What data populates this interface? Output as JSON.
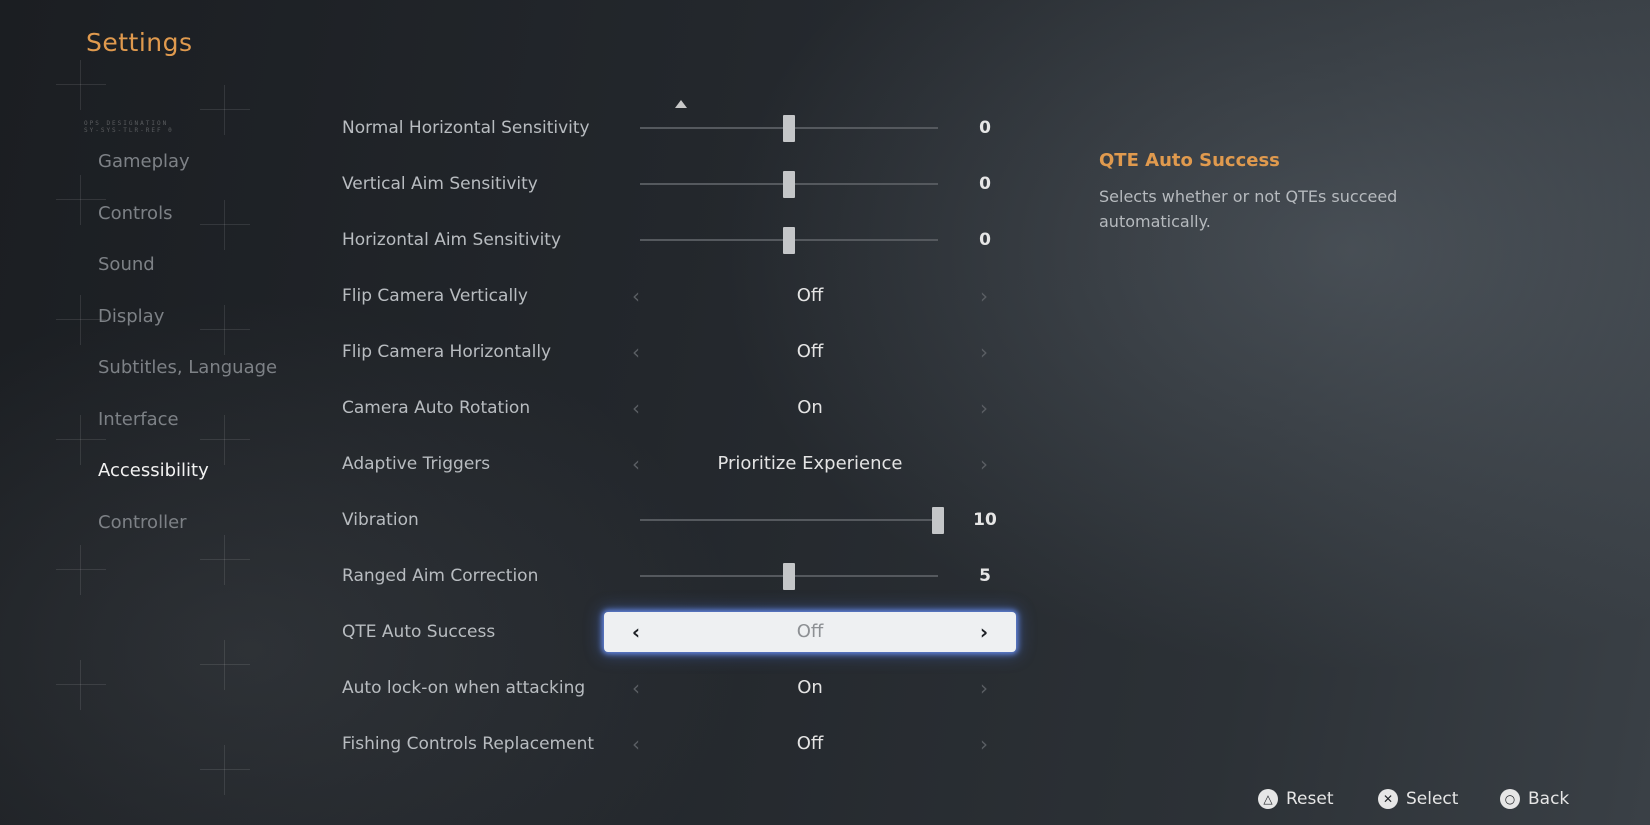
{
  "title": "Settings",
  "tiny_text": "OPS DESIGNATION\nSY-SYS-TLR-REF 0",
  "sidebar": {
    "items": [
      {
        "label": "Gameplay",
        "active": false
      },
      {
        "label": "Controls",
        "active": false
      },
      {
        "label": "Sound",
        "active": false
      },
      {
        "label": "Display",
        "active": false
      },
      {
        "label": "Subtitles, Language",
        "active": false
      },
      {
        "label": "Interface",
        "active": false
      },
      {
        "label": "Accessibility",
        "active": true
      },
      {
        "label": "Controller",
        "active": false
      }
    ]
  },
  "settings": [
    {
      "label": "Normal Horizontal Sensitivity",
      "type": "slider",
      "value": "0",
      "level": 0.5
    },
    {
      "label": "Vertical Aim Sensitivity",
      "type": "slider",
      "value": "0",
      "level": 0.5
    },
    {
      "label": "Horizontal Aim Sensitivity",
      "type": "slider",
      "value": "0",
      "level": 0.5
    },
    {
      "label": "Flip Camera Vertically",
      "type": "option",
      "value": "Off"
    },
    {
      "label": "Flip Camera Horizontally",
      "type": "option",
      "value": "Off"
    },
    {
      "label": "Camera Auto Rotation",
      "type": "option",
      "value": "On"
    },
    {
      "label": "Adaptive Triggers",
      "type": "option",
      "value": "Prioritize Experience"
    },
    {
      "label": "Vibration",
      "type": "slider",
      "value": "10",
      "level": 1.0
    },
    {
      "label": "Ranged Aim Correction",
      "type": "slider",
      "value": "5",
      "level": 0.5
    },
    {
      "label": "QTE Auto Success",
      "type": "option",
      "value": "Off",
      "selected": true
    },
    {
      "label": "Auto lock-on when attacking",
      "type": "option",
      "value": "On"
    },
    {
      "label": "Fishing Controls Replacement",
      "type": "option",
      "value": "Off"
    }
  ],
  "description": {
    "title": "QTE Auto Success",
    "text": "Selects whether or not QTEs succeed automatically."
  },
  "footer": {
    "reset": {
      "label": "Reset",
      "icon": "triangle-button-icon",
      "glyph": "△"
    },
    "select": {
      "label": "Select",
      "icon": "cross-button-icon",
      "glyph": "✕"
    },
    "back": {
      "label": "Back",
      "icon": "circle-button-icon",
      "glyph": "○"
    }
  },
  "colors": {
    "accent": "#e09a4e",
    "selection_glow": "#6e96ff"
  }
}
